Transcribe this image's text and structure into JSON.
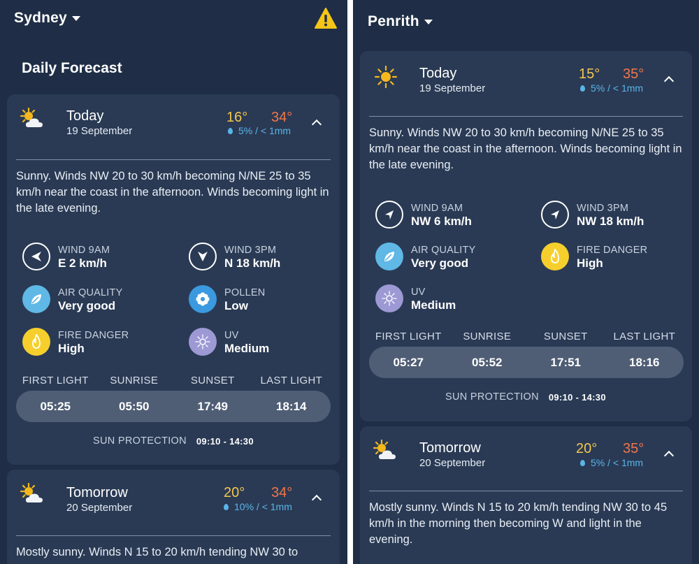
{
  "left": {
    "location": "Sydney",
    "section_title": "Daily Forecast",
    "today": {
      "name": "Today",
      "date": "19 September",
      "min": "16°",
      "max": "34°",
      "rain": "5% / < 1mm",
      "description": "Sunny. Winds NW 20 to 30 km/h becoming N/NE 25 to 35 km/h near the coast in the afternoon. Winds becoming light in the late evening.",
      "stats": {
        "wind9": {
          "label": "WIND 9AM",
          "value": "E 2 km/h",
          "icon": "wind-arrow-icon"
        },
        "wind3": {
          "label": "WIND 3PM",
          "value": "N 18 km/h",
          "icon": "wind-arrow-icon"
        },
        "air": {
          "label": "AIR QUALITY",
          "value": "Very good",
          "icon": "leaf-icon"
        },
        "pollen": {
          "label": "POLLEN",
          "value": "Low",
          "icon": "flower-icon"
        },
        "fire": {
          "label": "FIRE DANGER",
          "value": "High",
          "icon": "flame-icon"
        },
        "uv": {
          "label": "UV",
          "value": "Medium",
          "icon": "sun-rays-icon"
        }
      },
      "sun": {
        "labels": [
          "FIRST LIGHT",
          "SUNRISE",
          "SUNSET",
          "LAST LIGHT"
        ],
        "times": [
          "05:25",
          "05:50",
          "17:49",
          "18:14"
        ],
        "protection_label": "SUN PROTECTION",
        "protection_value": "09:10 - 14:30"
      }
    },
    "tomorrow": {
      "name": "Tomorrow",
      "date": "20 September",
      "min": "20°",
      "max": "34°",
      "rain": "10% / < 1mm",
      "description": "Mostly sunny. Winds N 15 to 20 km/h tending NW 30 to"
    }
  },
  "right": {
    "location": "Penrith",
    "today": {
      "name": "Today",
      "date": "19 September",
      "min": "15°",
      "max": "35°",
      "rain": "5% / < 1mm",
      "description": "Sunny. Winds NW 20 to 30 km/h becoming N/NE 25 to 35 km/h near the coast in the afternoon. Winds becoming light in the late evening.",
      "stats": {
        "wind9": {
          "label": "WIND 9AM",
          "value": "NW 6 km/h",
          "icon": "wind-arrow-icon"
        },
        "wind3": {
          "label": "WIND 3PM",
          "value": "NW 18 km/h",
          "icon": "wind-arrow-icon"
        },
        "air": {
          "label": "AIR QUALITY",
          "value": "Very good",
          "icon": "leaf-icon"
        },
        "fire": {
          "label": "FIRE DANGER",
          "value": "High",
          "icon": "flame-icon"
        },
        "uv": {
          "label": "UV",
          "value": "Medium",
          "icon": "sun-rays-icon"
        }
      },
      "sun": {
        "labels": [
          "FIRST LIGHT",
          "SUNRISE",
          "SUNSET",
          "LAST LIGHT"
        ],
        "times": [
          "05:27",
          "05:52",
          "17:51",
          "18:16"
        ],
        "protection_label": "SUN PROTECTION",
        "protection_value": "09:10 - 14:30"
      }
    },
    "tomorrow": {
      "name": "Tomorrow",
      "date": "20 September",
      "min": "20°",
      "max": "35°",
      "rain": "5% / < 1mm",
      "description": "Mostly sunny. Winds N 15 to 20 km/h tending NW 30 to 45 km/h in the morning then becoming W and light in the evening."
    }
  },
  "colors": {
    "background": "#1f2e46",
    "card": "#2a3a54",
    "temp_min": "#f4c74e",
    "temp_max": "#f2754a",
    "rain": "#5bb4e8",
    "warning": "#f5c518"
  }
}
